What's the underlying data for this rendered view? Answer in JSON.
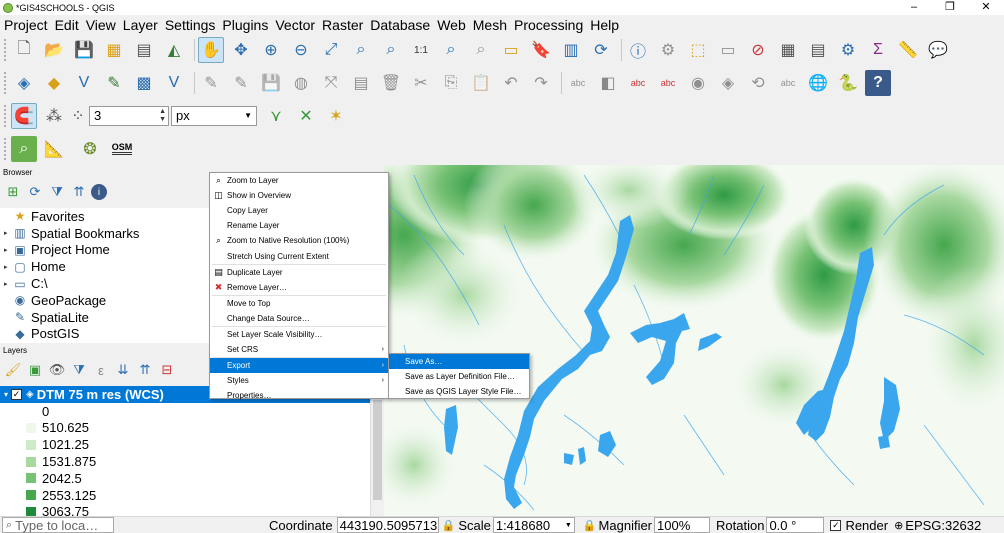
{
  "window": {
    "title": "*GIS4SCHOOLS - QGIS",
    "min": "–",
    "max": "❐",
    "close": "✕"
  },
  "menubar": [
    "Project",
    "Edit",
    "View",
    "Layer",
    "Settings",
    "Plugins",
    "Vector",
    "Raster",
    "Database",
    "Web",
    "Mesh",
    "Processing",
    "Help"
  ],
  "toolbar3": {
    "snap_tolerance": "3",
    "snap_units": "px"
  },
  "toolbar4": {
    "osm_label": "OSM"
  },
  "browser": {
    "title": "Browser",
    "items": [
      {
        "label": "Favorites",
        "icon": "★",
        "expander": ""
      },
      {
        "label": "Spatial Bookmarks",
        "icon": "▥",
        "expander": "▸"
      },
      {
        "label": "Project Home",
        "icon": "▣",
        "expander": "▸"
      },
      {
        "label": "Home",
        "icon": "▢",
        "expander": "▸"
      },
      {
        "label": "C:\\",
        "icon": "▭",
        "expander": "▸"
      },
      {
        "label": "GeoPackage",
        "icon": "◉",
        "expander": ""
      },
      {
        "label": "SpatiaLite",
        "icon": "✎",
        "expander": ""
      },
      {
        "label": "PostGIS",
        "icon": "◆",
        "expander": ""
      }
    ]
  },
  "layers": {
    "title": "Layers",
    "selected_layer": "DTM 75 m res (WCS)",
    "legend": [
      {
        "label": "0",
        "color": "#ffffff"
      },
      {
        "label": "510.625",
        "color": "#eef7ea"
      },
      {
        "label": "1021.25",
        "color": "#cfeac8"
      },
      {
        "label": "1531.875",
        "color": "#a8d8a0"
      },
      {
        "label": "2042.5",
        "color": "#78c275"
      },
      {
        "label": "2553.125",
        "color": "#46a74e"
      },
      {
        "label": "3063.75",
        "color": "#1f8a3c"
      }
    ]
  },
  "context_menu": {
    "items": [
      {
        "label": "Zoom to Layer",
        "icon": "⌕"
      },
      {
        "label": "Show in Overview",
        "icon": "◫"
      },
      {
        "label": "Copy Layer",
        "icon": ""
      },
      {
        "label": "Rename Layer",
        "icon": ""
      },
      {
        "label": "Zoom to Native Resolution (100%)",
        "icon": "⌕"
      },
      {
        "label": "Stretch Using Current Extent",
        "icon": ""
      },
      {
        "label": "Duplicate Layer",
        "icon": "▤"
      },
      {
        "label": "Remove Layer…",
        "icon": "✖"
      },
      {
        "label": "Move to Top",
        "icon": ""
      },
      {
        "label": "Change Data Source…",
        "icon": ""
      },
      {
        "label": "Set Layer Scale Visibility…",
        "icon": ""
      },
      {
        "label": "Set CRS",
        "icon": ""
      },
      {
        "label": "Export",
        "icon": ""
      },
      {
        "label": "Styles",
        "icon": ""
      },
      {
        "label": "Properties…",
        "icon": ""
      }
    ],
    "submenu_arrow": "›"
  },
  "export_submenu": [
    "Save As…",
    "Save as Layer Definition File…",
    "Save as QGIS Layer Style File…"
  ],
  "statusbar": {
    "locator_placeholder": "Type to loca…",
    "coordinate_label": "Coordinate",
    "coordinate_value": "443190.5095713",
    "scale_label": "Scale",
    "scale_value": "1:418680",
    "magnifier_label": "Magnifier",
    "magnifier_value": "100%",
    "rotation_label": "Rotation",
    "rotation_value": "0.0 °",
    "render_label": "Render",
    "crs": "EPSG:32632"
  },
  "colors": {
    "water": "#3aa6ee",
    "selection": "#0078d7",
    "terrain_high": "#2e9a45"
  }
}
